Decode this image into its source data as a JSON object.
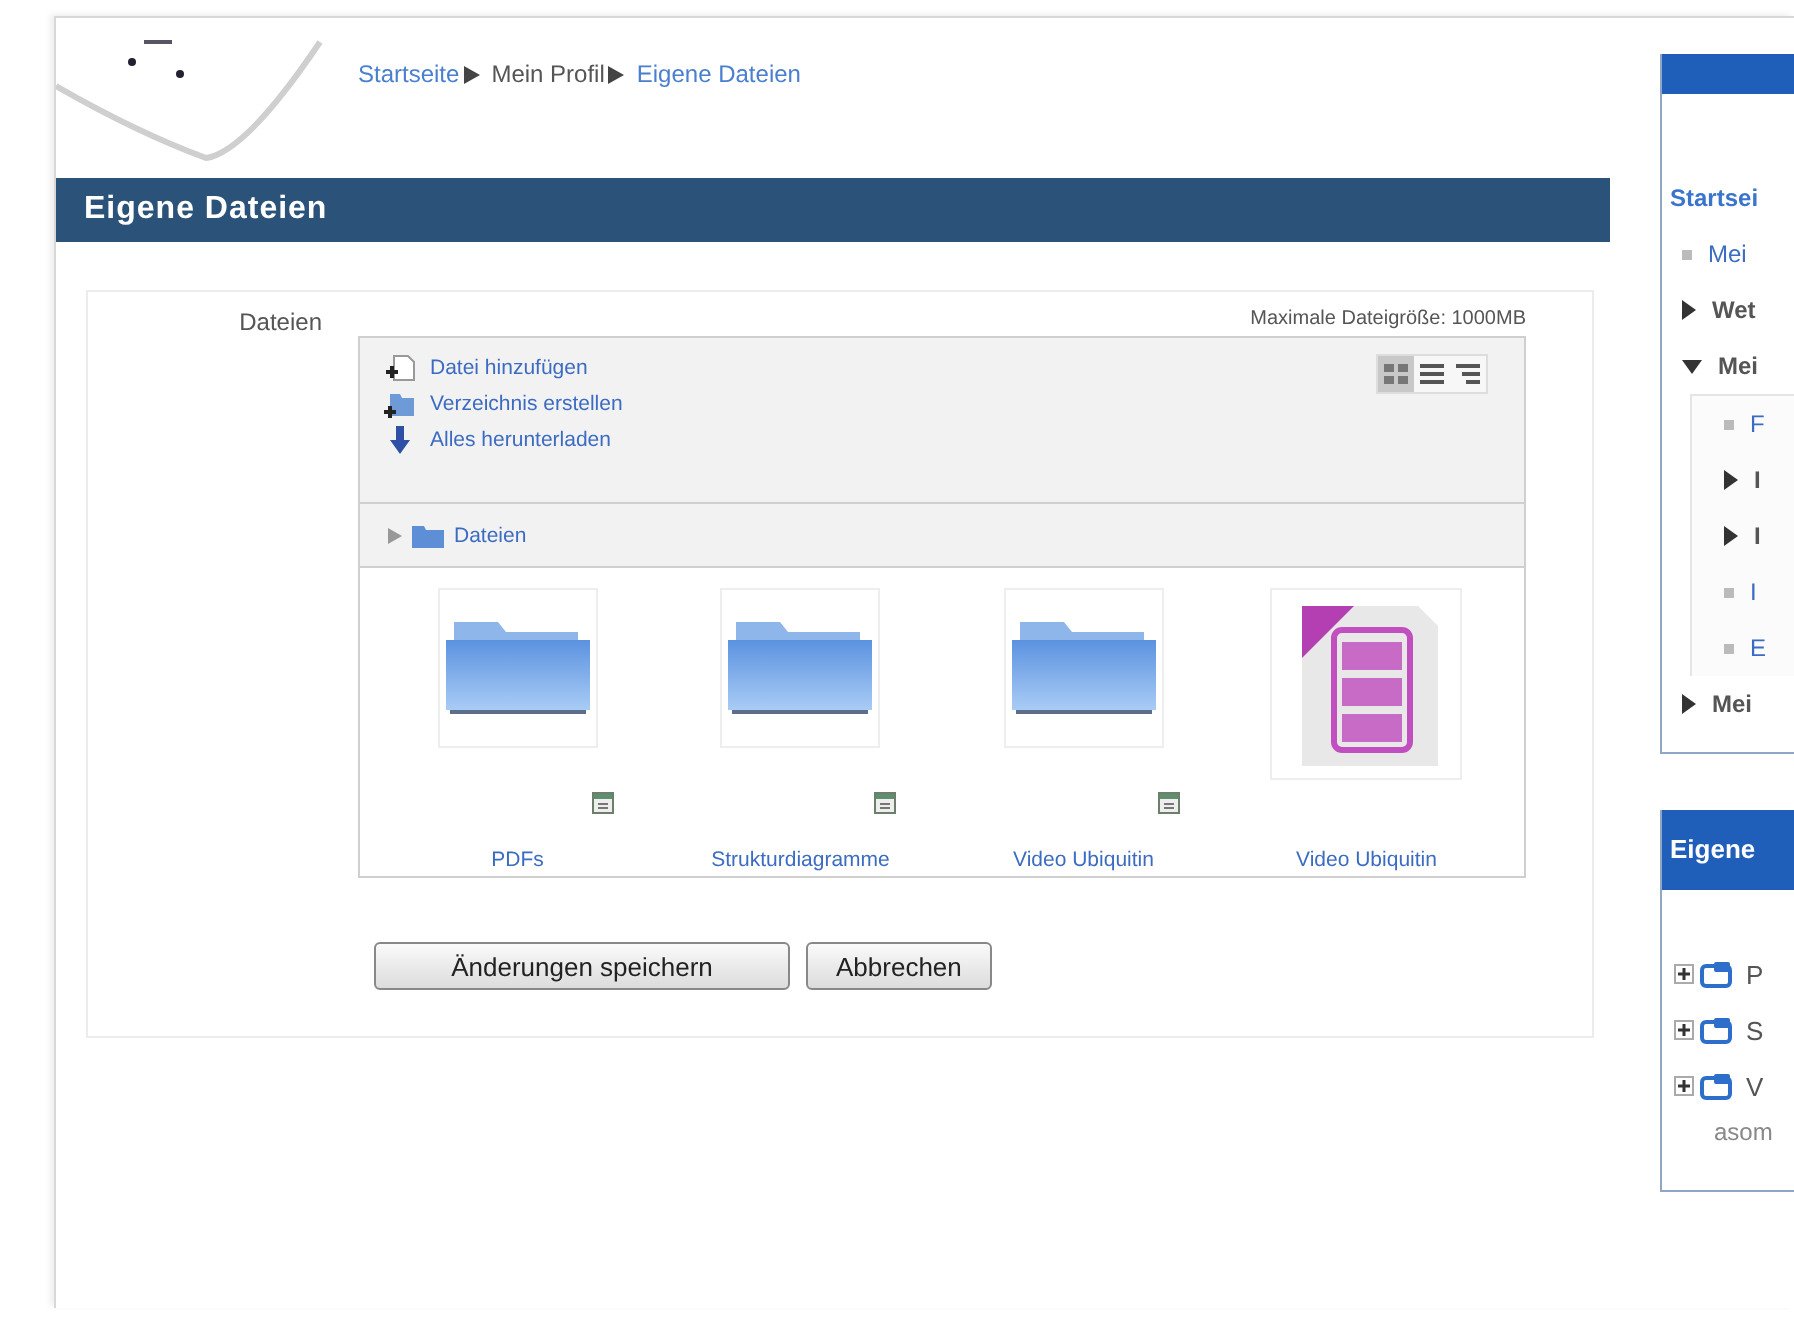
{
  "breadcrumb": [
    {
      "label": "Startseite",
      "link": true
    },
    {
      "label": "Mein Profil",
      "link": false
    },
    {
      "label": "Eigene Dateien",
      "link": true
    }
  ],
  "page_title": "Eigene Dateien",
  "form": {
    "label": "Dateien",
    "max_size": "Maximale Dateigröße: 1000MB",
    "actions": [
      {
        "kind": "add",
        "label": "Datei hinzufügen"
      },
      {
        "kind": "mkdir",
        "label": "Verzeichnis erstellen"
      },
      {
        "kind": "download",
        "label": "Alles herunterladen"
      }
    ],
    "view_modes": [
      {
        "kind": "icons",
        "selected": true
      },
      {
        "kind": "list",
        "selected": false
      },
      {
        "kind": "tree",
        "selected": false
      }
    ],
    "path": "Dateien",
    "files": [
      {
        "kind": "folder",
        "name": "PDFs"
      },
      {
        "kind": "folder",
        "name": "Strukturdiagramme"
      },
      {
        "kind": "folder",
        "name": "Video Ubiquitin"
      },
      {
        "kind": "file",
        "name": "Video Ubiquitin"
      }
    ],
    "buttons": [
      "Änderungen speichern",
      "Abbrechen"
    ]
  },
  "sidebar": {
    "navigation": {
      "items": [
        {
          "kind": "link",
          "label": "Startsei"
        },
        {
          "kind": "leaf",
          "label": "Mei"
        },
        {
          "kind": "collapsed",
          "label": "Wet"
        },
        {
          "kind": "expanded",
          "label": "Mei",
          "children": [
            {
              "kind": "leaf",
              "label": "F"
            },
            {
              "kind": "collapsed",
              "label": "I"
            },
            {
              "kind": "collapsed",
              "label": "I"
            },
            {
              "kind": "leaf",
              "label": "I"
            },
            {
              "kind": "leaf",
              "label": "E"
            }
          ]
        },
        {
          "kind": "collapsed",
          "label": "Mei"
        }
      ]
    },
    "files_block": {
      "title": "Eigene",
      "items": [
        "P",
        "S",
        "V"
      ],
      "footer": "asom"
    }
  }
}
